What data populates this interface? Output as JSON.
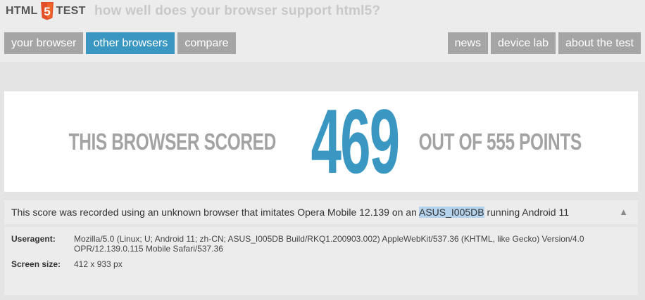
{
  "logo": {
    "left": "HTML",
    "badge": "5",
    "right": "TEST"
  },
  "tagline": "how well does your browser support html5?",
  "nav": {
    "left": [
      {
        "label": "your browser",
        "active": false
      },
      {
        "label": "other browsers",
        "active": true
      },
      {
        "label": "compare",
        "active": false
      }
    ],
    "right": [
      {
        "label": "news"
      },
      {
        "label": "device lab"
      },
      {
        "label": "about the test"
      }
    ]
  },
  "score": {
    "prefix": "THIS BROWSER SCORED",
    "value": "469",
    "suffix": "OUT OF 555 POINTS"
  },
  "info": {
    "before": "This score was recorded using an unknown browser that imitates Opera Mobile 12.139 on an ",
    "device": "ASUS_I005DB",
    "after": " running Android 11",
    "collapse_icon": "triangle-up"
  },
  "details": {
    "useragent_label": "Useragent:",
    "useragent_value": "Mozilla/5.0 (Linux; U; Android 11; zh-CN; ASUS_I005DB Build/RKQ1.200903.002) AppleWebKit/537.36 (KHTML, like Gecko) Version/4.0 OPR/12.139.0.115 Mobile Safari/537.36",
    "screen_label": "Screen size:",
    "screen_value": "412 x 933 px"
  },
  "colors": {
    "accent": "#3a97c2",
    "logo_orange": "#e34f26",
    "nav_gray": "#a5a5a5"
  }
}
